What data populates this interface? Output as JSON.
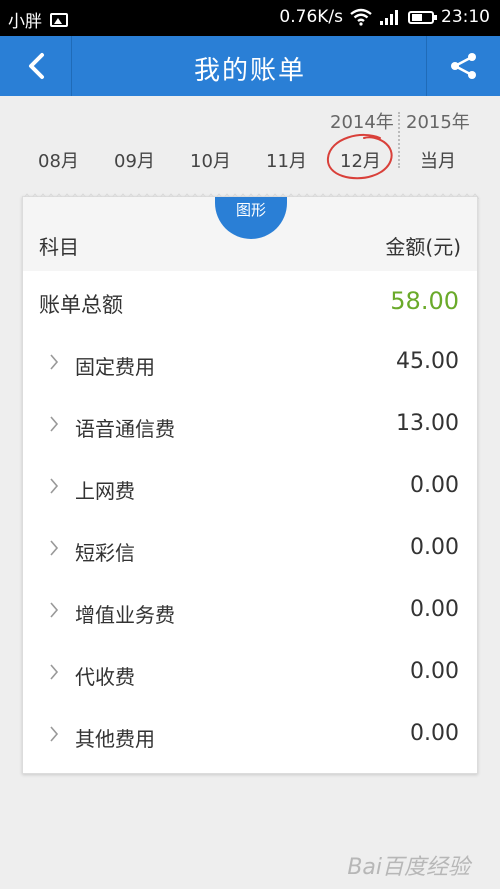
{
  "status_bar": {
    "carrier": "小胖",
    "network_speed": "0.76K/s",
    "time": "23:10"
  },
  "appbar": {
    "title": "我的账单"
  },
  "years": [
    "2014年",
    "2015年"
  ],
  "months": [
    "08月",
    "09月",
    "10月",
    "11月",
    "12月",
    "当月"
  ],
  "selected_month_index": 4,
  "card": {
    "tab_label": "图形",
    "header": {
      "item_label": "科目",
      "amount_label": "金额(元)"
    },
    "total": {
      "label": "账单总额",
      "value": "58.00"
    },
    "items": [
      {
        "label": "固定费用",
        "value": "45.00"
      },
      {
        "label": "语音通信费",
        "value": "13.00"
      },
      {
        "label": "上网费",
        "value": "0.00"
      },
      {
        "label": "短彩信",
        "value": "0.00"
      },
      {
        "label": "增值业务费",
        "value": "0.00"
      },
      {
        "label": "代收费",
        "value": "0.00"
      },
      {
        "label": "其他费用",
        "value": "0.00"
      }
    ]
  },
  "watermark": "Bai百度经验",
  "colors": {
    "primary": "#2a7fd6",
    "total_green": "#6aaa2a",
    "circle_red": "#d9403a"
  }
}
